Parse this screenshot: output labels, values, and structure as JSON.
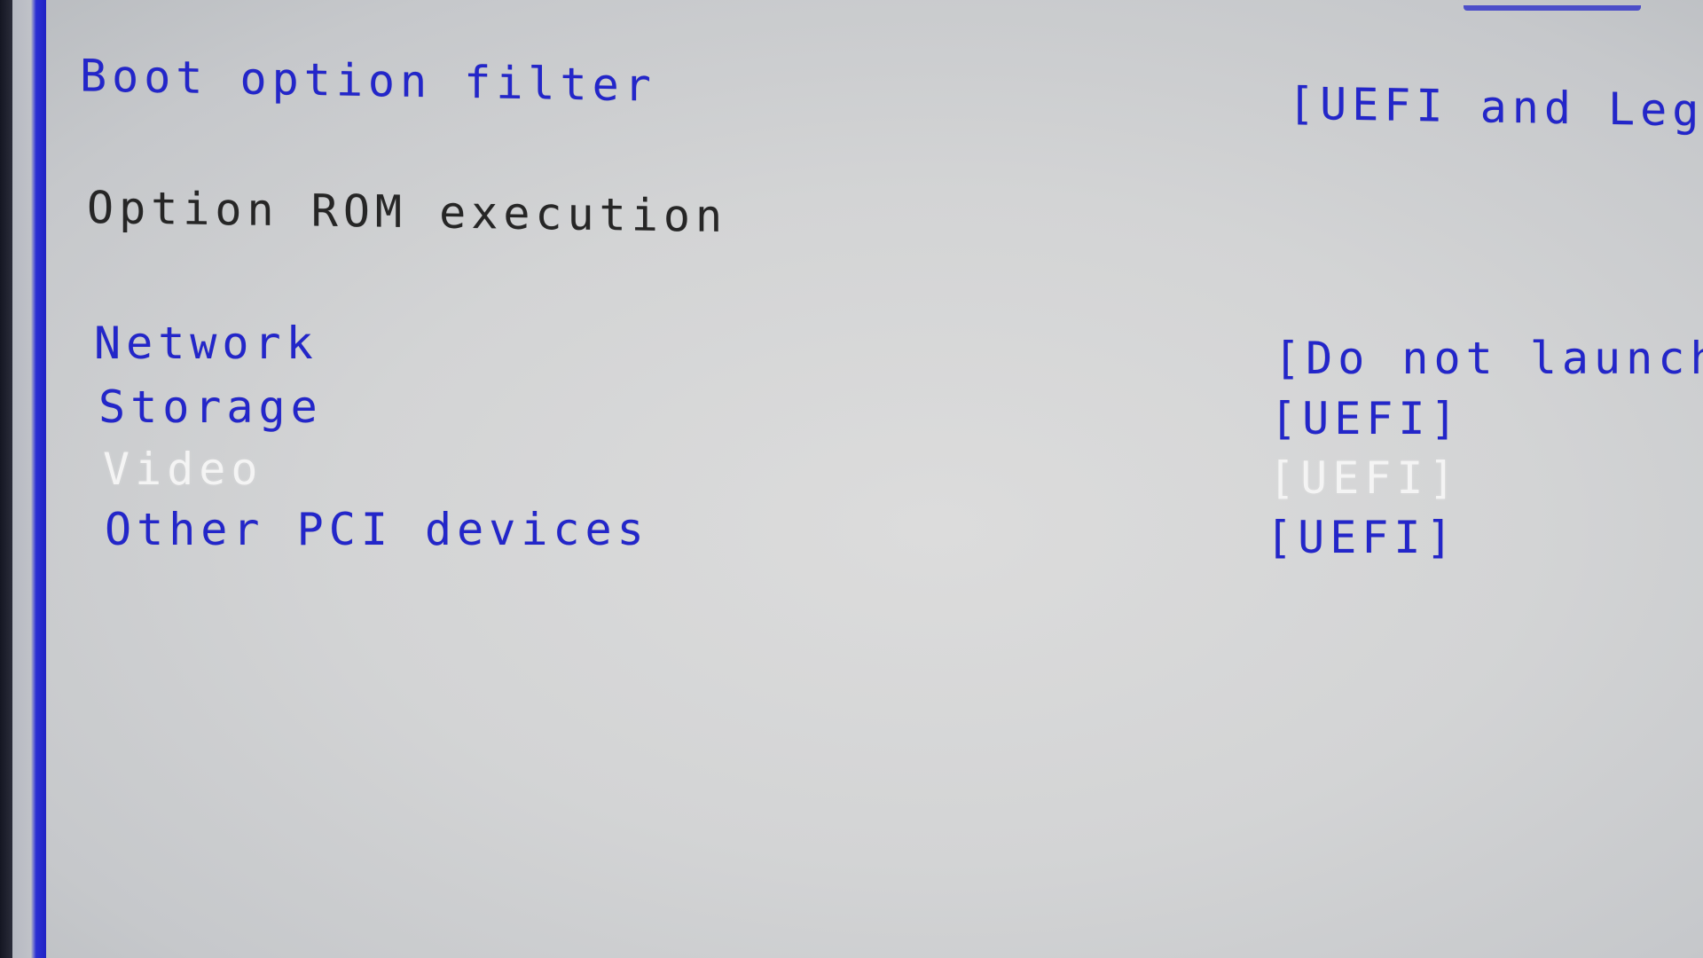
{
  "boot_option_filter": {
    "label": "Boot option filter",
    "value": "[UEFI and Lega"
  },
  "option_rom_execution": {
    "heading": "Option ROM execution",
    "items": [
      {
        "label": "Network",
        "value": "[Do not launch]",
        "selected": false
      },
      {
        "label": "Storage",
        "value": "[UEFI]",
        "selected": false
      },
      {
        "label": "Video",
        "value": "[UEFI]",
        "selected": true
      },
      {
        "label": "Other PCI devices",
        "value": "[UEFI]",
        "selected": false
      }
    ]
  },
  "colors": {
    "background": "#d4d5d6",
    "option_text": "#2326c9",
    "heading_text": "#262626",
    "selected_text": "#f4f4f4",
    "panel_border": "#1f22c4"
  }
}
